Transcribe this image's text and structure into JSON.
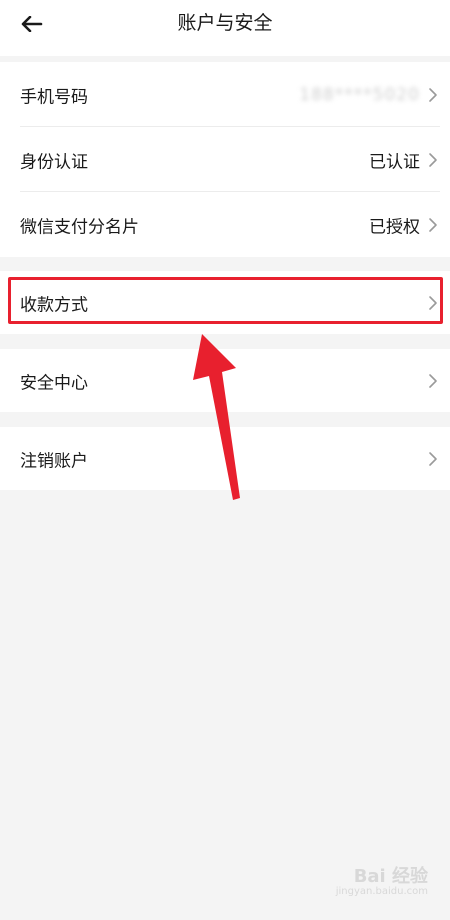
{
  "header": {
    "title": "账户与安全",
    "back_icon": "arrow-left-icon"
  },
  "groups": [
    {
      "rows": [
        {
          "label": "手机号码",
          "value": "188****5020",
          "value_obscured": true
        },
        {
          "label": "身份认证",
          "value": "已认证"
        },
        {
          "label": "微信支付分名片",
          "value": "已授权"
        }
      ]
    },
    {
      "rows": [
        {
          "label": "收款方式",
          "value": ""
        }
      ]
    },
    {
      "rows": [
        {
          "label": "安全中心",
          "value": ""
        }
      ]
    },
    {
      "rows": [
        {
          "label": "注销账户",
          "value": ""
        }
      ]
    }
  ],
  "annotation": {
    "highlight_target": "收款方式",
    "color": "#e8202e"
  },
  "watermark": {
    "text": "Bai 经验",
    "sub": "jingyan.baidu.com"
  },
  "colors": {
    "background": "#f4f4f4",
    "card": "#ffffff",
    "text": "#1a1a1a",
    "chevron": "#9a9a9a",
    "divider": "#ececec"
  }
}
